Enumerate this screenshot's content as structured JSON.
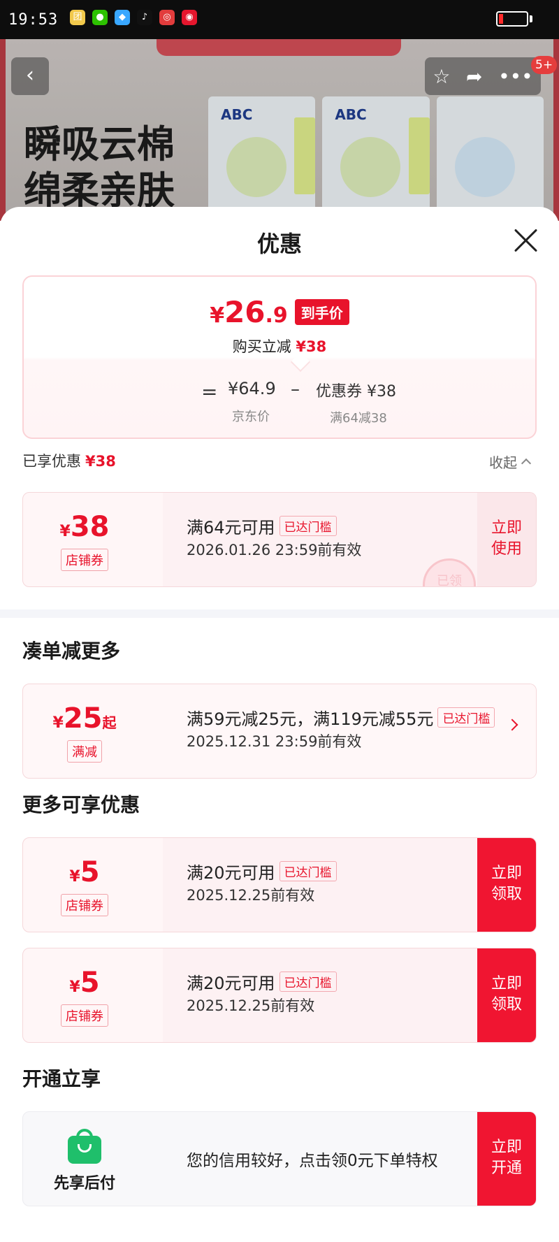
{
  "status_bar": {
    "time": "19:53",
    "app_icons": [
      {
        "name": "meituan-icon",
        "glyph": "团",
        "color": "#f2c94c"
      },
      {
        "name": "wechat-icon",
        "glyph": "●",
        "color": "#2dc100"
      },
      {
        "name": "qq-icon",
        "glyph": "◆",
        "color": "#39a7ff"
      },
      {
        "name": "tiktok-icon",
        "glyph": "♪",
        "color": "#111111"
      },
      {
        "name": "netease-music-icon",
        "glyph": "◎",
        "color": "#e23c3c"
      },
      {
        "name": "weibo-icon",
        "glyph": "◉",
        "color": "#e6162d"
      }
    ]
  },
  "product": {
    "slogan_line1": "瞬吸云棉",
    "slogan_line2": "绵柔亲肤",
    "brand": "ABC",
    "notification_badge": "5+"
  },
  "sheet": {
    "title": "优惠",
    "summary": {
      "yen": "¥",
      "price_int": "26",
      "price_dec": ".9",
      "price_tag": "到手价",
      "reduce_text": "购买立减",
      "reduce_amount": "¥38",
      "equals": "=",
      "jd_price": "¥64.9",
      "jd_label": "京东价",
      "minus": "–",
      "coupon_text": "优惠券 ¥38",
      "coupon_label": "满64减38"
    },
    "enjoyed_label": "已享优惠",
    "enjoyed_amount": "¥38",
    "collapse_label": "收起",
    "applied_coupon": {
      "yen": "¥",
      "amount": "38",
      "type": "店铺券",
      "title": "满64元可用",
      "flag": "已达门槛",
      "date": "2026.01.26 23:59前有效",
      "action": "立即使用",
      "stamp": "已领"
    },
    "sections": {
      "bundle_title": "凑单减更多",
      "more_title": "更多可享优惠",
      "open_title": "开通立享"
    },
    "bundle_offer": {
      "yen": "¥",
      "amount": "25",
      "suffix": "起",
      "type": "满减",
      "title": "满59元减25元，满119元减55元",
      "flag": "已达门槛",
      "date": "2025.12.31 23:59前有效"
    },
    "more_coupons": [
      {
        "yen": "¥",
        "amount": "5",
        "type": "店铺券",
        "title": "满20元可用",
        "flag": "已达门槛",
        "date": "2025.12.25前有效",
        "action": "立即领取"
      },
      {
        "yen": "¥",
        "amount": "5",
        "type": "店铺券",
        "title": "满20元可用",
        "flag": "已达门槛",
        "date": "2025.12.25前有效",
        "action": "立即领取"
      }
    ],
    "bnpl": {
      "label": "先享后付",
      "text": "您的信用较好，点击领0元下单特权",
      "action": "立即开通"
    }
  }
}
